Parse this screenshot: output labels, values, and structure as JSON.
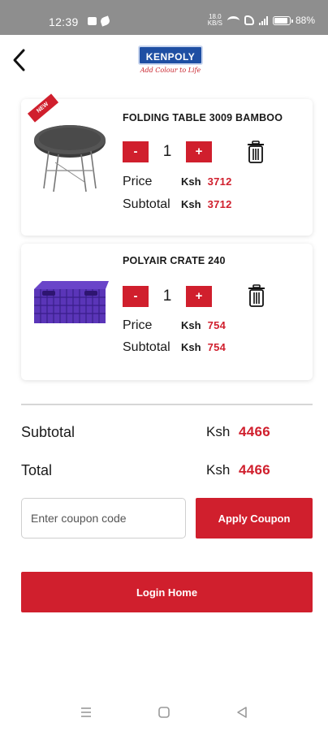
{
  "status_bar": {
    "time": "12:39",
    "speed_top": "18.0",
    "speed_bottom": "KB/S",
    "battery": "88%",
    "battery_level": 0.88
  },
  "header": {
    "logo_text": "KENPOLY",
    "logo_tagline": "Add Colour to Life",
    "brand_color": "#1f4fa3"
  },
  "cart": {
    "items": [
      {
        "name": "FOLDING TABLE 3009 BAMBOO",
        "ribbon": "NEW",
        "quantity": "1",
        "minus_label": "-",
        "plus_label": "+",
        "price_label": "Price",
        "price_currency": "Ksh",
        "price_value": "3712",
        "subtotal_label": "Subtotal",
        "subtotal_currency": "Ksh",
        "subtotal_value": "3712"
      },
      {
        "name": "POLYAIR CRATE 240",
        "quantity": "1",
        "minus_label": "-",
        "plus_label": "+",
        "price_label": "Price",
        "price_currency": "Ksh",
        "price_value": "754",
        "subtotal_label": "Subtotal",
        "subtotal_currency": "Ksh",
        "subtotal_value": "754"
      }
    ]
  },
  "summary": {
    "subtotal_label": "Subtotal",
    "subtotal_currency": "Ksh",
    "subtotal_value": "4466",
    "total_label": "Total",
    "total_currency": "Ksh",
    "total_value": "4466"
  },
  "coupon": {
    "placeholder": "Enter coupon code",
    "apply_label": "Apply Coupon"
  },
  "login_button_label": "Login Home",
  "colors": {
    "accent": "#d01f2d",
    "status_bar": "#8e8e8e"
  },
  "icons": {
    "back": "back-arrow-icon",
    "trash": "trash-icon",
    "nav_recents": "menu-icon",
    "nav_home": "square-icon",
    "nav_back": "triangle-back-icon"
  }
}
